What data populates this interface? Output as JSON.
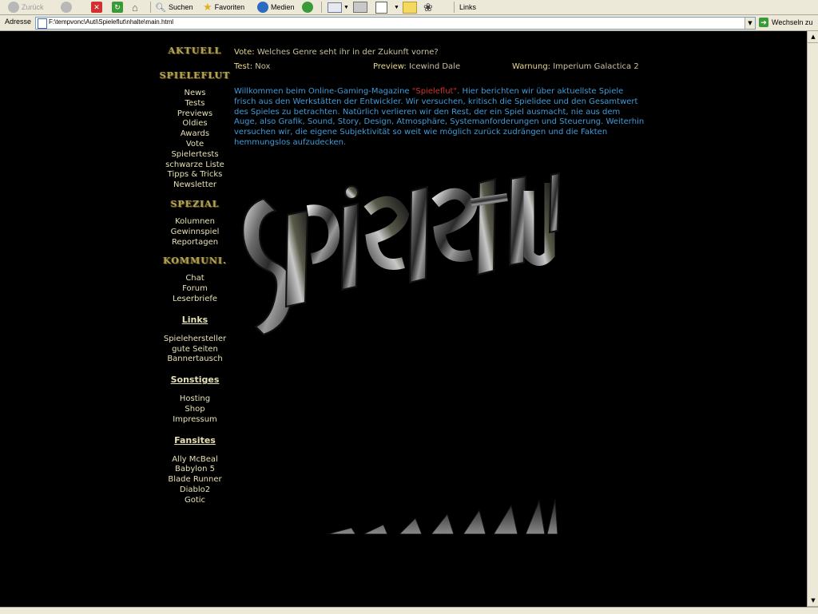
{
  "toolbar": {
    "back_label": "Zurück",
    "search_label": "Suchen",
    "favorites_label": "Favoriten",
    "media_label": "Medien",
    "links_label": "Links"
  },
  "address": {
    "label": "Adresse",
    "url": "F:\\tempvonc\\Auti\\Spieleflut\\nhalte\\main.html",
    "go_label": "Wechseln zu"
  },
  "nav": {
    "section_aktuell": "AKTUELL",
    "section_spieleflut": "SPIELEFLUT",
    "spieleflut_items": [
      "News",
      "Tests",
      "Previews",
      "Oldies",
      "Awards",
      "Vote",
      "Spielertests",
      "schwarze Liste",
      "Tipps & Tricks",
      "Newsletter"
    ],
    "section_spezial": "SPEZIAL",
    "spezial_items": [
      "Kolumnen",
      "Gewinnspiel",
      "Reportagen"
    ],
    "section_kommuni": "KOMMUNI.",
    "kommuni_items": [
      "Chat",
      "Forum",
      "Leserbriefe"
    ],
    "section_links": "Links",
    "links_items": [
      "Spielehersteller",
      "gute Seiten",
      "Bannertausch"
    ],
    "section_sonstiges": "Sonstiges",
    "sonstiges_items": [
      "Hosting",
      "Shop",
      "Impressum"
    ],
    "section_fansites": "Fansites",
    "fansites_items": [
      "Ally McBeal",
      "Babylon 5",
      "Blade Runner",
      "Diablo2",
      "Gotic"
    ]
  },
  "main": {
    "vote_label": "Vote:",
    "vote_text": "Welches Genre seht ihr in der Zukunft vorne?",
    "test_label": "Test:",
    "test_value": "Nox",
    "preview_label": "Preview:",
    "preview_value": "Icewind Dale",
    "warning_label": "Warnung:",
    "warning_value": "Imperium Galactica 2",
    "intro_before": "Willkommen beim Online-Gaming-Magazine ",
    "intro_brand": "\"Spieleflut\"",
    "intro_after": ". Hier berichten wir über aktuellste Spiele frisch aus den Werkstätten der Entwickler. Wir versuchen, kritisch die Spielidee und den Gesamtwert des Spieles zu betrachten. Natürlich verlieren wir den Rest, der ein Spiel ausmacht, nie aus dem Auge, also Grafik, Sound, Story, Design, Atmosphäre, Systemanforderungen und Steuerung. Weiterhin versuchen wir, die eigene Subjektivität so weit wie möglich zurück zudrängen und die Fakten hemmungslos aufzudecken."
  },
  "colors": {
    "page_bg": "#000000",
    "nav_text": "#e6e0b4",
    "nav_heading": "#b3a35a",
    "intro_text": "#3e9ad8",
    "brand_red": "#d23030",
    "label_gold": "#e6d890"
  },
  "icons": [
    "back-icon",
    "forward-icon",
    "stop-icon",
    "refresh-icon",
    "home-icon",
    "search-icon",
    "favorites-icon",
    "media-icon",
    "history-icon",
    "mail-icon",
    "print-icon",
    "edit-icon",
    "folder-icon",
    "messenger-icon",
    "page-icon",
    "go-icon"
  ]
}
